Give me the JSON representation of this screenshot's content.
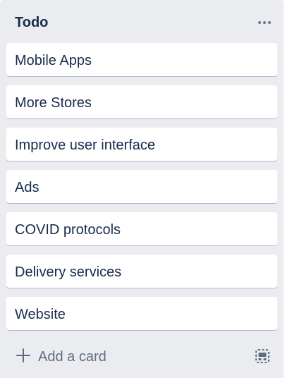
{
  "list": {
    "title": "Todo",
    "more_icon": "more-horizontal-icon",
    "cards": [
      {
        "label": "Mobile Apps"
      },
      {
        "label": "More Stores"
      },
      {
        "label": "Improve user interface"
      },
      {
        "label": "Ads"
      },
      {
        "label": "COVID protocols"
      },
      {
        "label": "Delivery services"
      },
      {
        "label": "Website"
      }
    ],
    "footer": {
      "add_icon": "plus-icon",
      "add_label": "Add a card",
      "template_icon": "card-template-icon"
    }
  },
  "colors": {
    "list_background": "#ebecf0",
    "card_background": "#ffffff",
    "title_text": "#172b4d",
    "muted_text": "#5e6c84"
  }
}
